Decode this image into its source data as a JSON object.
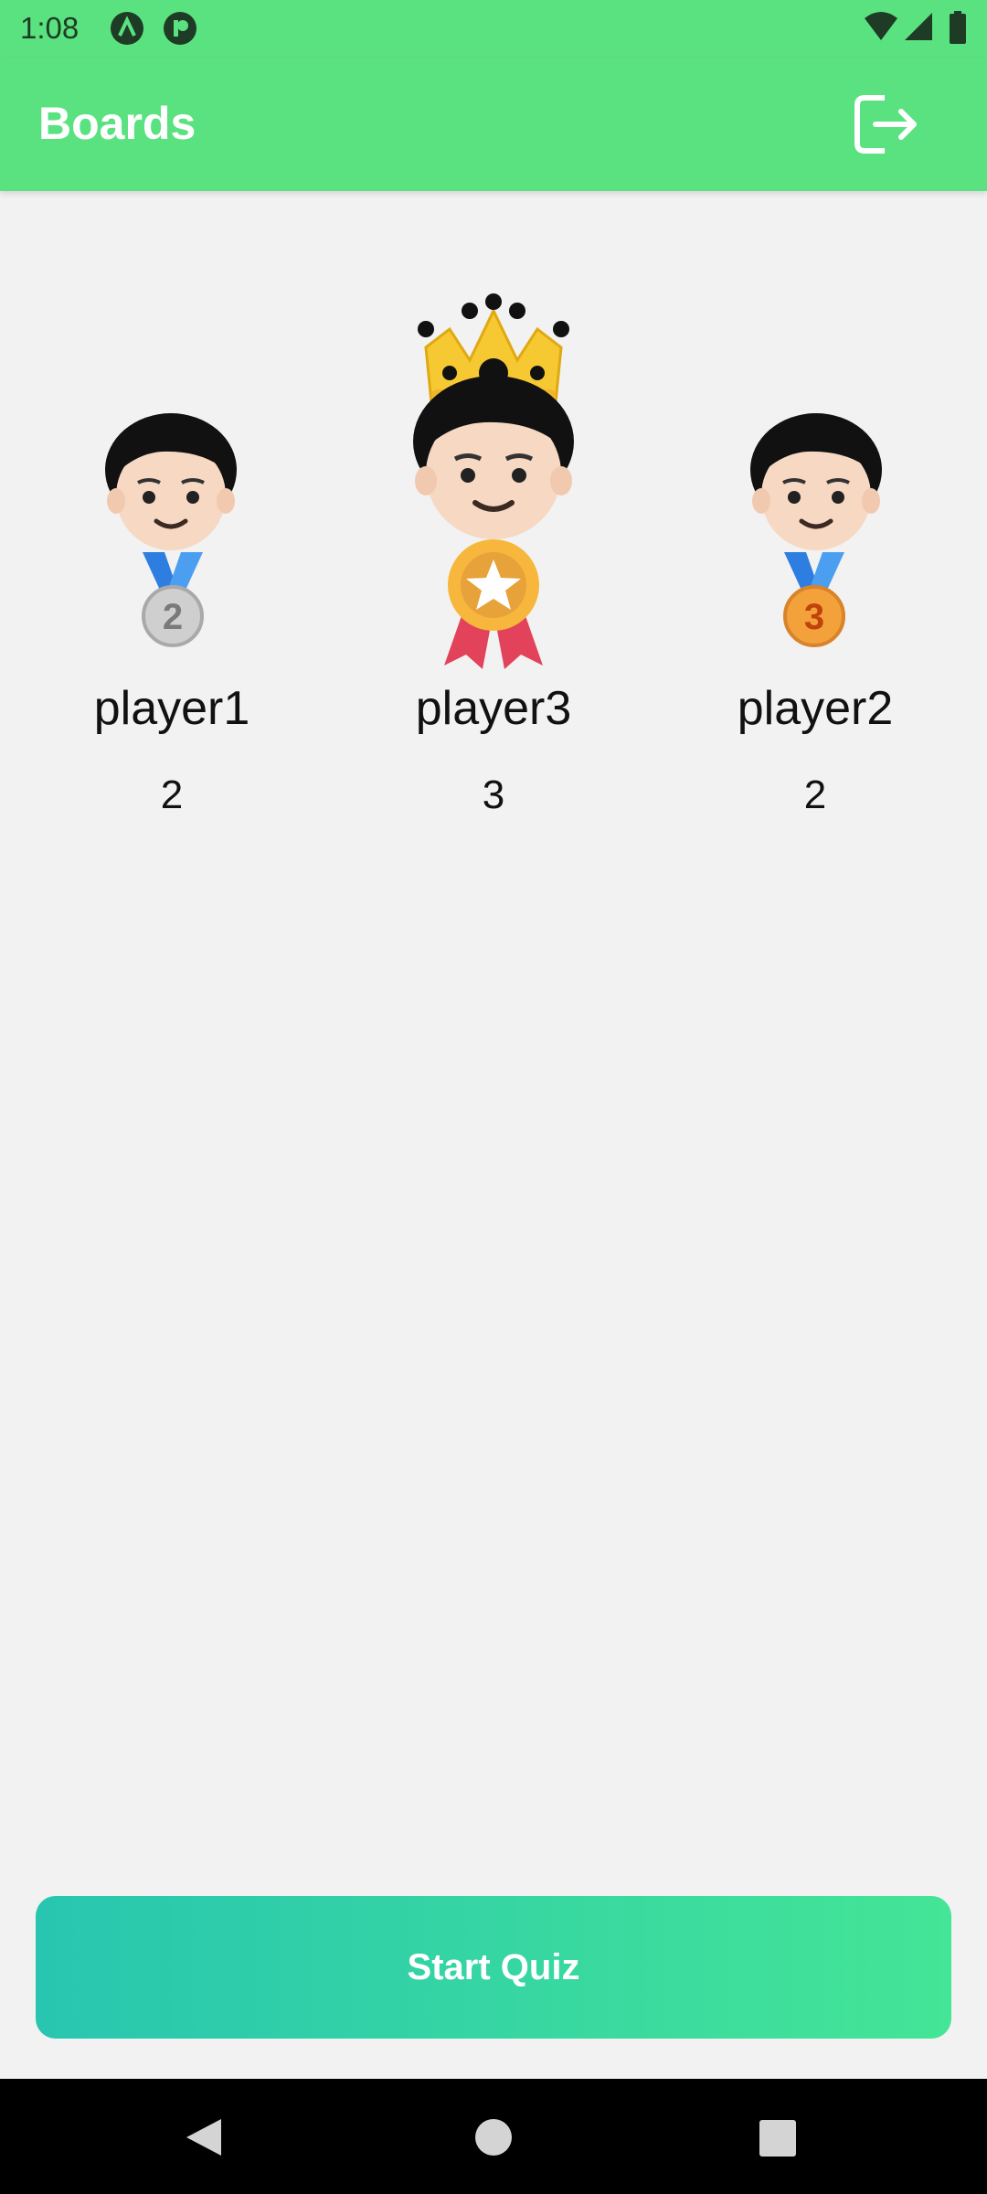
{
  "status_bar": {
    "time": "1:08",
    "app_icons": [
      "a-app-icon",
      "r-app-icon"
    ],
    "right_icons": [
      "wifi-icon",
      "signal-icon",
      "battery-icon"
    ]
  },
  "app_bar": {
    "title": "Boards",
    "action_icon": "logout-icon"
  },
  "leaderboard": [
    {
      "name": "player1",
      "score": "2",
      "rank_badge": "2",
      "avatar_icon": "boy-face-icon",
      "medal_icon": "silver-medal-icon"
    },
    {
      "name": "player3",
      "score": "3",
      "rank_badge": "",
      "avatar_icon": "boy-face-icon",
      "medal_icon": "gold-rosette-icon",
      "crown_icon": "crown-icon"
    },
    {
      "name": "player2",
      "score": "2",
      "rank_badge": "3",
      "avatar_icon": "boy-face-icon",
      "medal_icon": "bronze-medal-icon"
    }
  ],
  "start_button": {
    "label": "Start Quiz"
  },
  "nav_bar": {
    "icons": [
      "back-icon",
      "home-icon",
      "recents-icon"
    ]
  },
  "colors": {
    "primary": "#5be280",
    "background": "#f2f2f2",
    "button_gradient_start": "#28c6b0",
    "button_gradient_end": "#44e596"
  }
}
